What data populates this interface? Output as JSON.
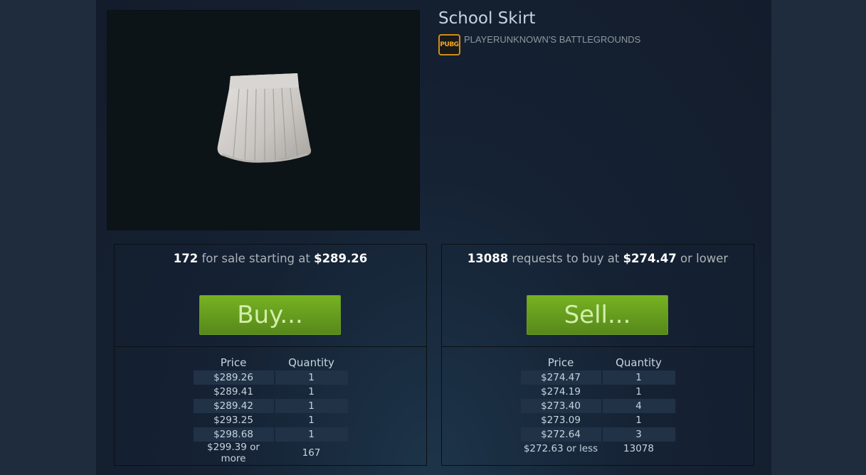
{
  "item": {
    "title": "School Skirt",
    "game_name": "PLAYERUNKNOWN'S BATTLEGROUNDS",
    "game_icon_text": "PUBG",
    "image_icon": "skirt-image"
  },
  "sell_panel": {
    "count": "172",
    "text_mid": "for sale starting at",
    "price": "$289.26",
    "button_label": "Buy...",
    "col_price": "Price",
    "col_qty": "Quantity",
    "rows": [
      {
        "price": "$289.26",
        "qty": "1"
      },
      {
        "price": "$289.41",
        "qty": "1"
      },
      {
        "price": "$289.42",
        "qty": "1"
      },
      {
        "price": "$293.25",
        "qty": "1"
      },
      {
        "price": "$298.68",
        "qty": "1"
      },
      {
        "price": "$299.39 or more",
        "qty": "167"
      }
    ]
  },
  "buy_panel": {
    "count": "13088",
    "text_mid": "requests to buy at",
    "price": "$274.47",
    "text_end": "or lower",
    "button_label": "Sell...",
    "col_price": "Price",
    "col_qty": "Quantity",
    "rows": [
      {
        "price": "$274.47",
        "qty": "1"
      },
      {
        "price": "$274.19",
        "qty": "1"
      },
      {
        "price": "$273.40",
        "qty": "4"
      },
      {
        "price": "$273.09",
        "qty": "1"
      },
      {
        "price": "$272.64",
        "qty": "3"
      },
      {
        "price": "$272.63 or less",
        "qty": "13078"
      }
    ]
  },
  "colors": {
    "background": "#1b2838",
    "button_green": "#75b022",
    "button_text": "#d2efa9",
    "game_icon_orange": "#f2a51d"
  }
}
